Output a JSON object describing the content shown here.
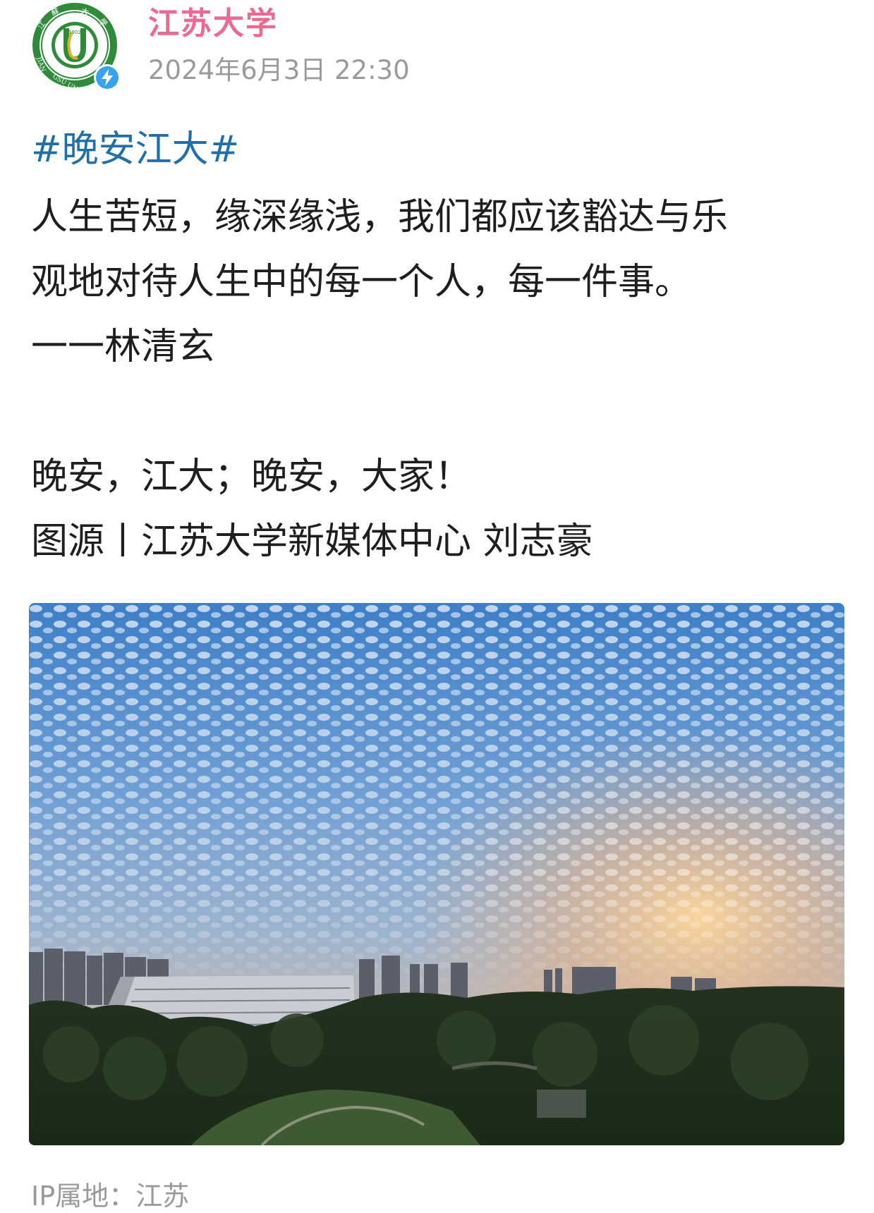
{
  "account": {
    "name": "江苏大学",
    "avatar_icon": "jiangsu-university-logo",
    "verified_icon": "verified-lightning-badge",
    "brand_color": "#eb6a8e",
    "logo_ring_text": "江苏大学",
    "logo_bottom_text": "JIANGSU UNIVERSITY",
    "logo_year": "1902",
    "logo_letter": "U"
  },
  "post": {
    "timestamp": "2024年6月3日 22:30",
    "hashtag": "#晚安江大#",
    "hashtag_color": "#1f6fa8",
    "lines": [
      "人生苦短，缘深缘浅，我们都应该豁达与乐",
      "观地对待人生中的每一个人，每一件事。",
      "一一林清玄"
    ],
    "greeting": "晚安，江大；晚安，大家！",
    "credit": "图源丨江苏大学新媒体中心 刘志豪",
    "image_description_icon": "campus-sunset-photo"
  },
  "footer": {
    "ip_location": "IP属地：江苏"
  }
}
